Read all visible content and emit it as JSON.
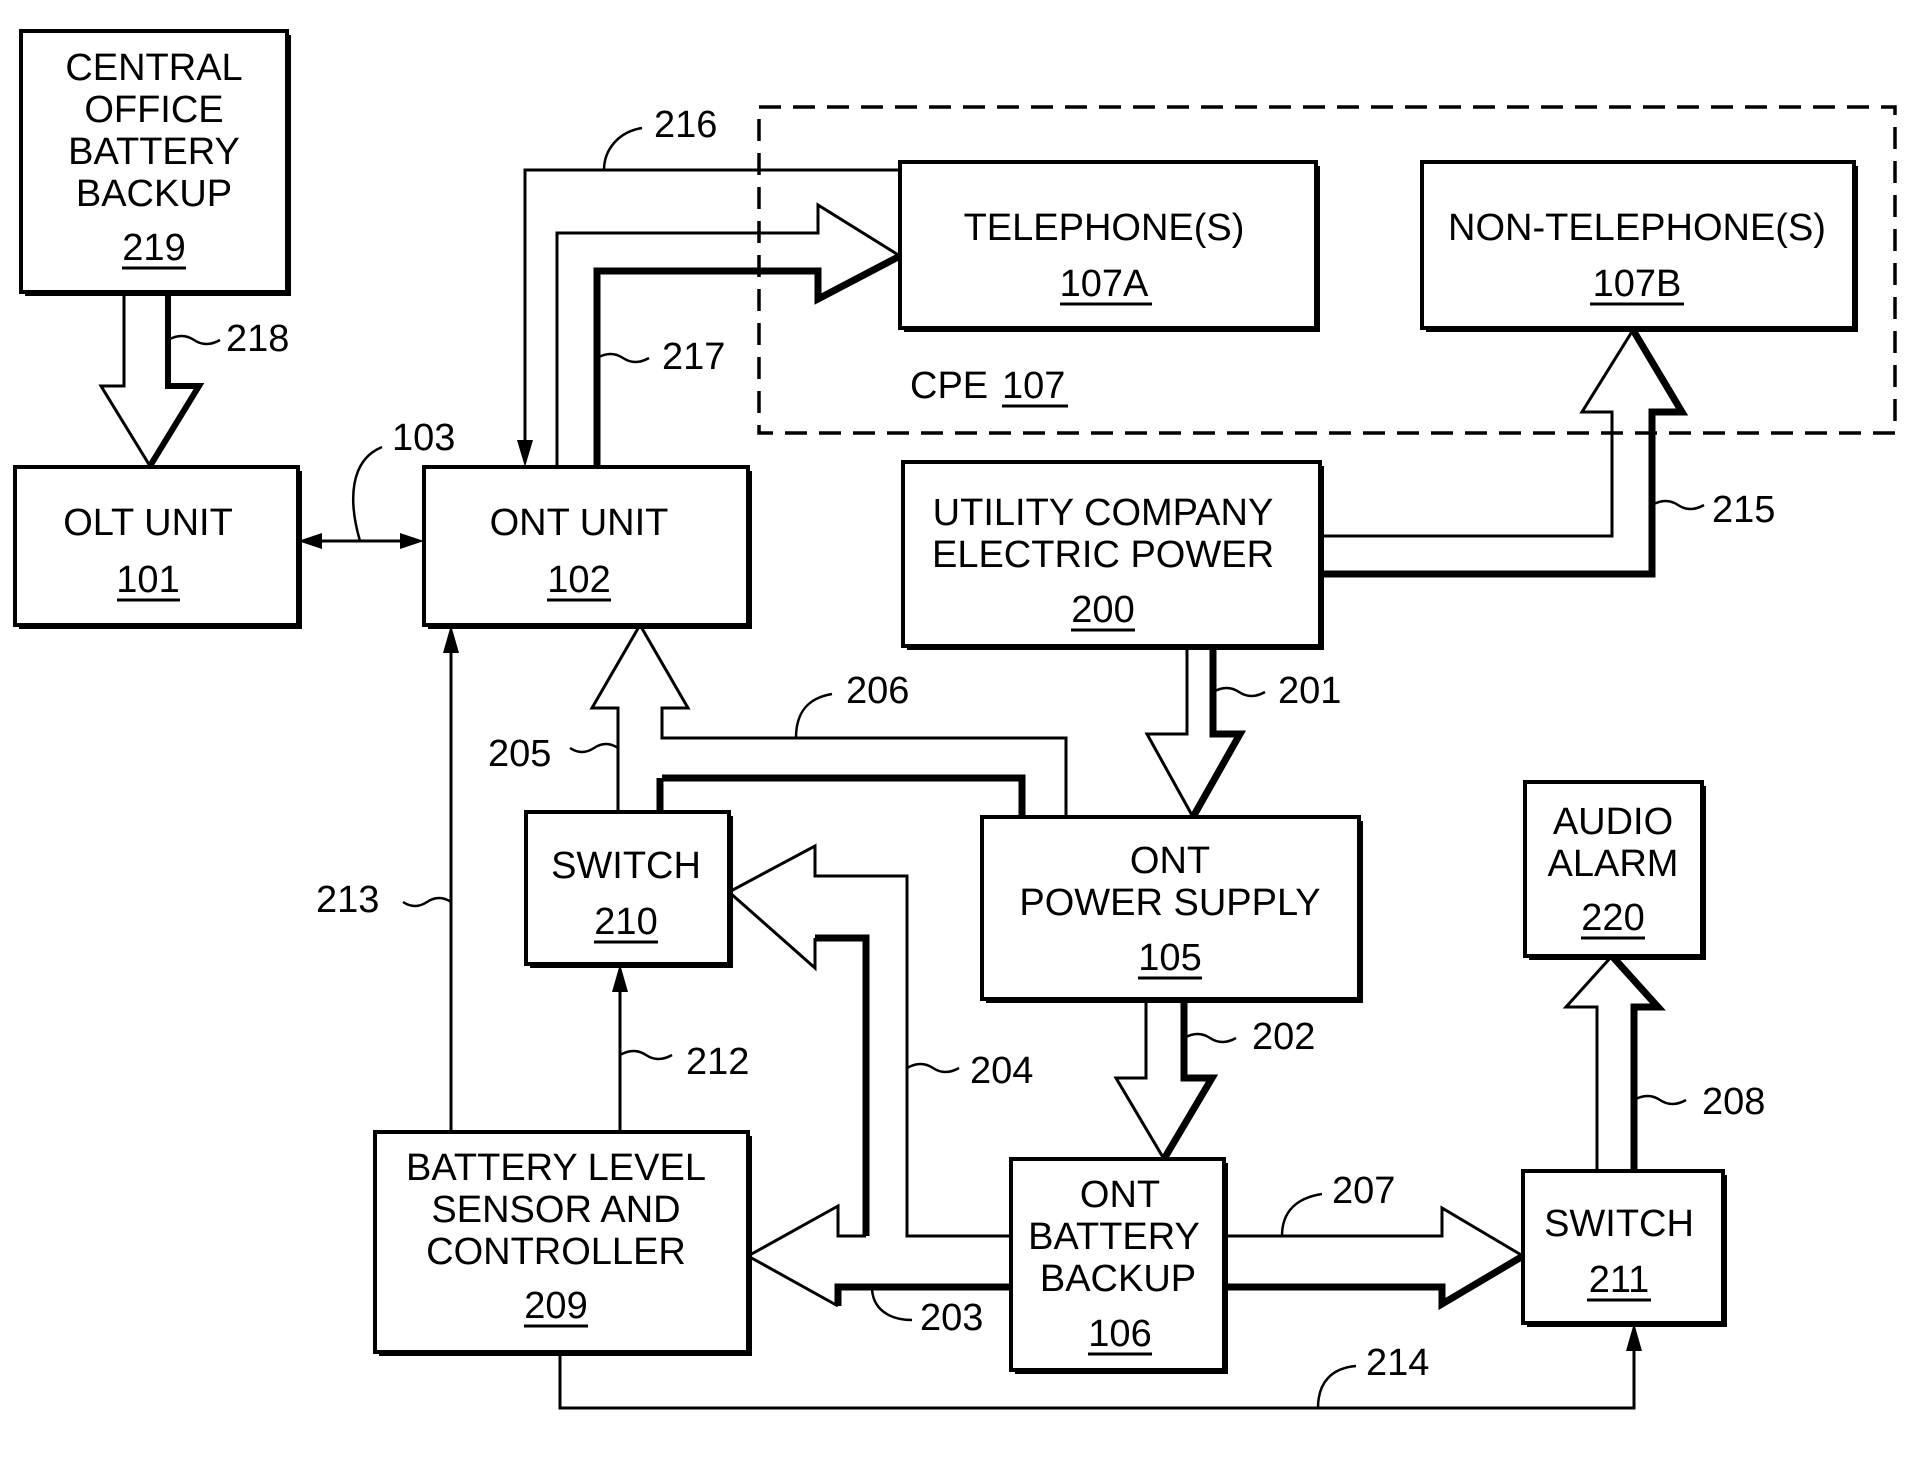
{
  "diagram": {
    "blocks": {
      "central_office": {
        "lines": [
          "CENTRAL",
          "OFFICE",
          "BATTERY",
          "BACKUP"
        ],
        "ref": "219"
      },
      "olt": {
        "lines": [
          "OLT UNIT"
        ],
        "ref": "101"
      },
      "ont": {
        "lines": [
          "ONT UNIT"
        ],
        "ref": "102"
      },
      "telephones": {
        "lines": [
          "TELEPHONE(S)"
        ],
        "ref": "107A"
      },
      "non_telephones": {
        "lines": [
          "NON-TELEPHONE(S)"
        ],
        "ref": "107B"
      },
      "utility": {
        "lines": [
          "UTILITY COMPANY",
          "ELECTRIC POWER"
        ],
        "ref": "200"
      },
      "switch_210": {
        "lines": [
          "SWITCH"
        ],
        "ref": "210"
      },
      "ont_power_supply": {
        "lines": [
          "ONT",
          "POWER SUPPLY"
        ],
        "ref": "105"
      },
      "audio_alarm": {
        "lines": [
          "AUDIO",
          "ALARM"
        ],
        "ref": "220"
      },
      "battery_sensor": {
        "lines": [
          "BATTERY LEVEL",
          "SENSOR AND",
          "CONTROLLER"
        ],
        "ref": "209"
      },
      "ont_battery": {
        "lines": [
          "ONT",
          "BATTERY",
          "BACKUP"
        ],
        "ref": "106"
      },
      "switch_211": {
        "lines": [
          "SWITCH"
        ],
        "ref": "211"
      }
    },
    "cpe_group": {
      "label": "CPE",
      "ref": "107"
    },
    "connection_refs": {
      "r103": "103",
      "r201": "201",
      "r202": "202",
      "r203": "203",
      "r204": "204",
      "r205": "205",
      "r206": "206",
      "r207": "207",
      "r208": "208",
      "r212": "212",
      "r213": "213",
      "r214": "214",
      "r215": "215",
      "r216": "216",
      "r217": "217",
      "r218": "218"
    }
  }
}
